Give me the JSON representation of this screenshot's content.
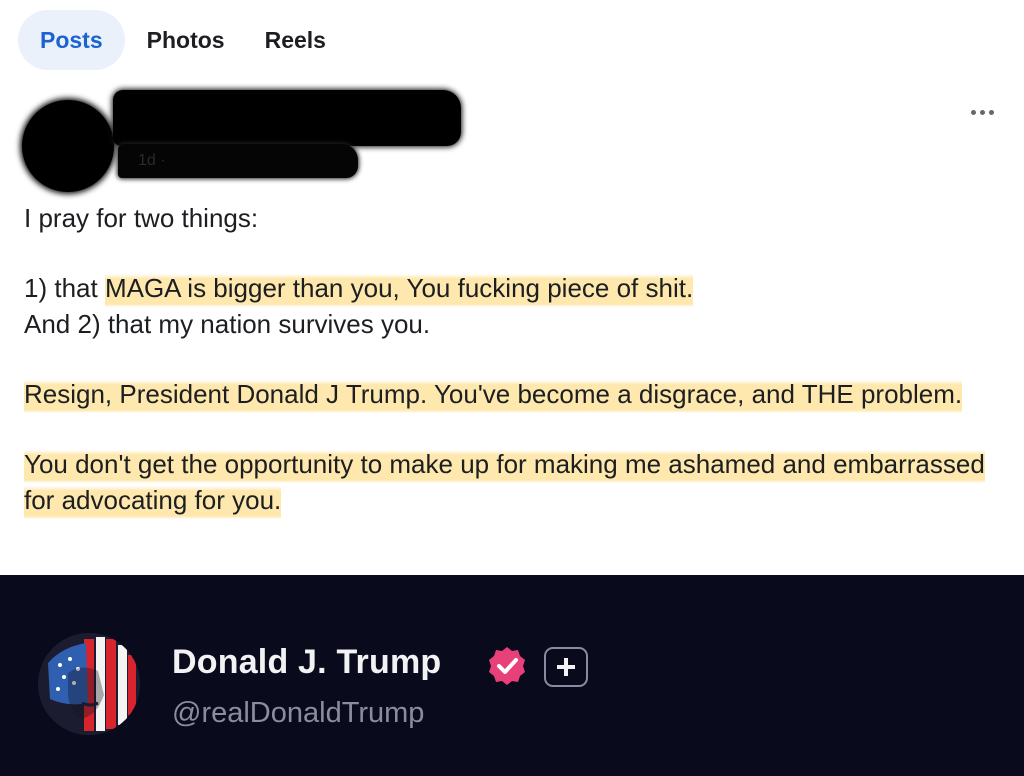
{
  "tabs": [
    {
      "label": "Posts",
      "active": true
    },
    {
      "label": "Photos",
      "active": false
    },
    {
      "label": "Reels",
      "active": false
    }
  ],
  "post": {
    "meta_partial": "1d ·",
    "paragraphs": {
      "p1": "I pray for two things:",
      "p2_prefix": "1) that ",
      "p2_highlight": "MAGA is bigger than you, You fucking piece of shit.",
      "p3": "And 2) that my nation survives you.",
      "p4": "Resign, President Donald J Trump. You've become a disgrace, and THE problem.",
      "p5": "You don't get the opportunity to make up for making me ashamed and embarrassed for advocating for you."
    }
  },
  "profile": {
    "name": "Donald J. Trump",
    "handle": "@realDonaldTrump"
  },
  "colors": {
    "tab_active_bg": "#eaf1fb",
    "tab_active_text": "#1b63d0",
    "highlight": "#fde196",
    "profile_bg": "#0a0a1d",
    "verified_badge": "#e8417a"
  },
  "icons": {
    "more": "more-horizontal-icon",
    "verified": "verified-badge-icon",
    "plus": "plus-box-icon"
  }
}
